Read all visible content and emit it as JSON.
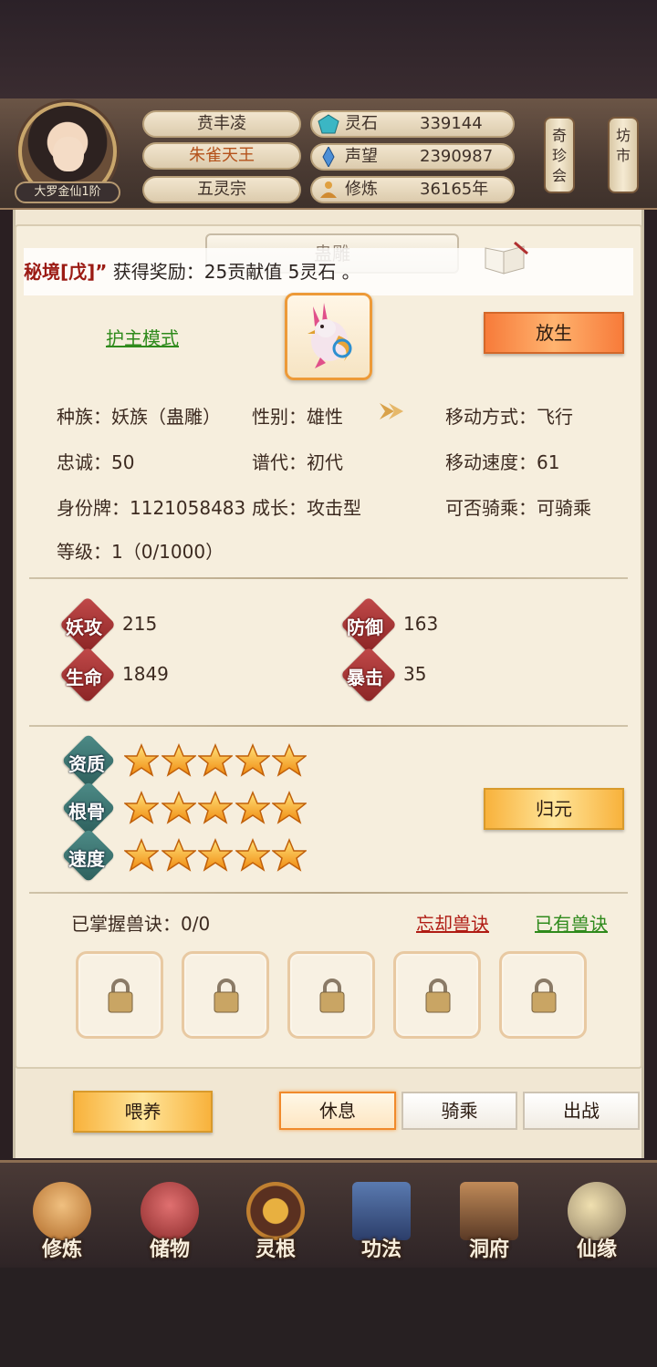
{
  "header": {
    "rank_badge": "大罗金仙1阶",
    "name": "贲丰凌",
    "title": "朱雀天王",
    "sect": "五灵宗",
    "resources": [
      {
        "icon": "spirit-stone-icon",
        "label": "灵石",
        "value": "339144"
      },
      {
        "icon": "reputation-icon",
        "label": "声望",
        "value": "2390987"
      },
      {
        "icon": "cultivation-icon",
        "label": "修炼",
        "value": "36165年"
      }
    ],
    "side_buttons": [
      {
        "chars": [
          "奇",
          "珍",
          "会"
        ]
      },
      {
        "chars": [
          "坊",
          "市"
        ]
      }
    ]
  },
  "panel": {
    "title": "蛊雕",
    "notice_red": "秘境[戊]”",
    "notice_text": "获得奖励：25贡献值 5灵石 。",
    "guard_mode": "护主模式",
    "release_button": "放生"
  },
  "info": {
    "row1": [
      "种族：妖族（蛊雕）",
      "性别：雄性",
      "移动方式：飞行"
    ],
    "row2": [
      "忠诚：50",
      "谱代：初代",
      "移动速度：61"
    ],
    "row3": [
      "身份牌：1121058483",
      "成长：攻击型",
      "可否骑乘：可骑乘"
    ],
    "row4": [
      "等级：1（0/1000）"
    ]
  },
  "stats": [
    {
      "label": "妖攻",
      "value": "215"
    },
    {
      "label": "防御",
      "value": "163"
    },
    {
      "label": "生命",
      "value": "1849"
    },
    {
      "label": "暴击",
      "value": "35"
    }
  ],
  "qualities": [
    {
      "label": "资质",
      "stars": 5
    },
    {
      "label": "根骨",
      "stars": 5
    },
    {
      "label": "速度",
      "stars": 5
    }
  ],
  "reset_button": "归元",
  "skills": {
    "mastered": "已掌握兽诀：0/0",
    "forget_link": "忘却兽诀",
    "owned_link": "已有兽诀",
    "slots": 5
  },
  "actions": {
    "feed": "喂养",
    "rest": "休息",
    "ride": "骑乘",
    "battle": "出战"
  },
  "nav": [
    {
      "label": "修炼"
    },
    {
      "label": "储物"
    },
    {
      "label": "灵根"
    },
    {
      "label": "功法"
    },
    {
      "label": "洞府"
    },
    {
      "label": "仙缘"
    }
  ],
  "colors": {
    "accent_orange": "#f77b3a",
    "link_green": "#2f8a1c",
    "link_red": "#b01c14",
    "stat_red": "#b23a3a",
    "quality_teal": "#3f7c78"
  }
}
